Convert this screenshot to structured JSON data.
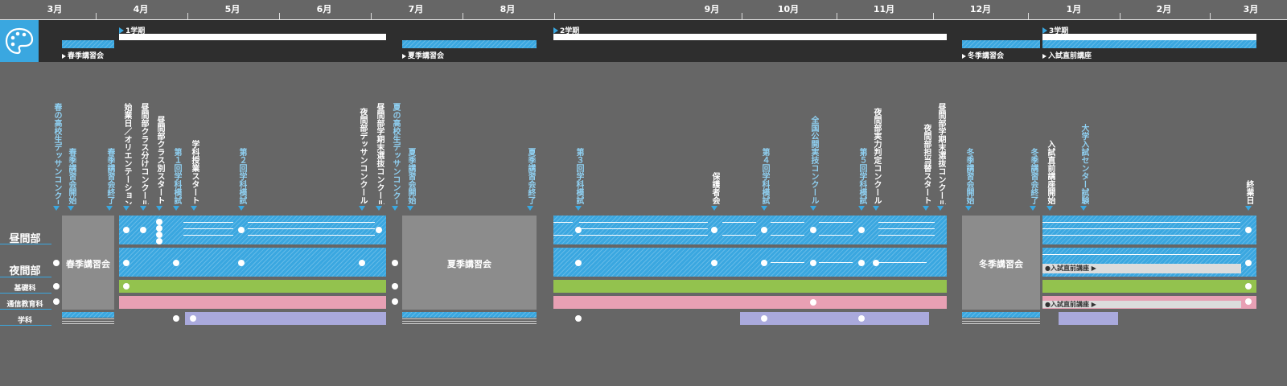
{
  "months": [
    "3月",
    "4月",
    "5月",
    "6月",
    "7月",
    "8月",
    "9月",
    "10月",
    "11月",
    "12月",
    "1月",
    "2月",
    "3月"
  ],
  "terms": [
    {
      "name": "1学期"
    },
    {
      "name": "2学期"
    },
    {
      "name": "3学期"
    }
  ],
  "seasonal": [
    {
      "name": "春季講習会"
    },
    {
      "name": "夏季講習会"
    },
    {
      "name": "冬季講習会"
    },
    {
      "name": "入試直前講座"
    }
  ],
  "events": [
    "春の高校生デッサンコンクール",
    "春季講習会開始",
    "春季講習会終了",
    "始業日／オリエンテーション",
    "昼間部クラス分けコンクール",
    "昼間部クラス別スタート",
    "第１回学科模試",
    "学科授業スタート",
    "第２回学科模試",
    "夜間部デッサンコンクール",
    "昼間部学期末選抜コンクール",
    "夏の高校生デッサンコンクール",
    "夏季講習会開始",
    "夏季講習会終了",
    "第３回学科模試",
    "保護者会",
    "第４回学科模試",
    "全国公開実技コンクール",
    "第５回学科模試",
    "夜間部実力判定コンクール",
    "夜間部担当替スタート",
    "昼間部学期末選抜コンクール",
    "冬季講習会開始",
    "冬季講習会終了",
    "入試直前講座開始",
    "大学入試センター試験",
    "終業日"
  ],
  "rows": [
    {
      "name": "昼間部"
    },
    {
      "name": "夜間部"
    },
    {
      "name": "基礎科"
    },
    {
      "name": "通信教育科"
    },
    {
      "name": "学科"
    }
  ],
  "boxes": {
    "spring": "春季講習会",
    "summer": "夏季講習会",
    "winter": "冬季講習会"
  },
  "notes": {
    "night": "●入試直前講座 ▶",
    "correspondence": "●入試直前講座 ▶"
  },
  "colors": {
    "accent": "#3aa7e0",
    "basic": "#93c24e",
    "correspondence": "#e8a0b4",
    "academic": "#a9a9dc",
    "session_box": "#8c8c8c"
  },
  "logo_icon": "palette-icon"
}
